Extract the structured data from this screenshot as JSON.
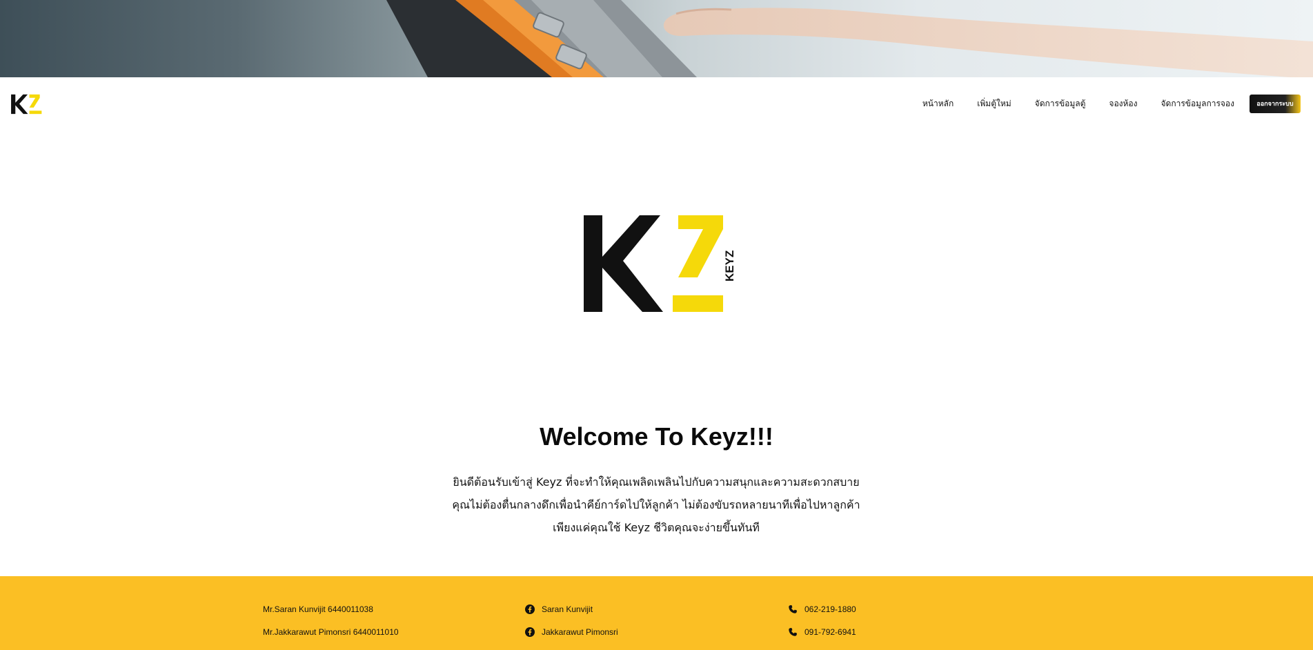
{
  "nav": {
    "items": [
      {
        "label": "หน้าหลัก"
      },
      {
        "label": "เพิ่มตู้ใหม่"
      },
      {
        "label": "จัดการข้อมูลตู้"
      },
      {
        "label": "จองห้อง"
      },
      {
        "label": "จัดการข้อมูลการจอง"
      }
    ],
    "logout_label": "ออกจากระบบ"
  },
  "logo": {
    "text": "KEYZ",
    "primary_color": "#111111",
    "accent_color": "#f5d90a"
  },
  "welcome": {
    "title": "Welcome To Keyz!!!",
    "lines": [
      "ยินดีต้อนรับเข้าสู่ Keyz ที่จะทำให้คุณเพลิดเพลินไปกับความสนุกและความสะดวกสบาย",
      "คุณไม่ต้องตื่นกลางดึกเพื่อนำคีย์การ์ดไปให้ลูกค้า ไม่ต้องขับรถหลายนาทีเพื่อไปหาลูกค้า",
      "เพียงแค่คุณใช้ Keyz ชีวิตคุณจะง่ายขึ้นทันที"
    ]
  },
  "footer": {
    "background": "#fbbf24",
    "members": [
      {
        "name": "Mr.Saran Kunvijit 6440011038",
        "facebook": "Saran Kunvijit",
        "phone": "062-219-1880"
      },
      {
        "name": "Mr.Jakkarawut Pimonsri 6440011010",
        "facebook": "Jakkarawut Pimonsri",
        "phone": "091-792-6941"
      }
    ],
    "icons": {
      "facebook": "facebook-icon",
      "phone": "phone-icon"
    }
  }
}
